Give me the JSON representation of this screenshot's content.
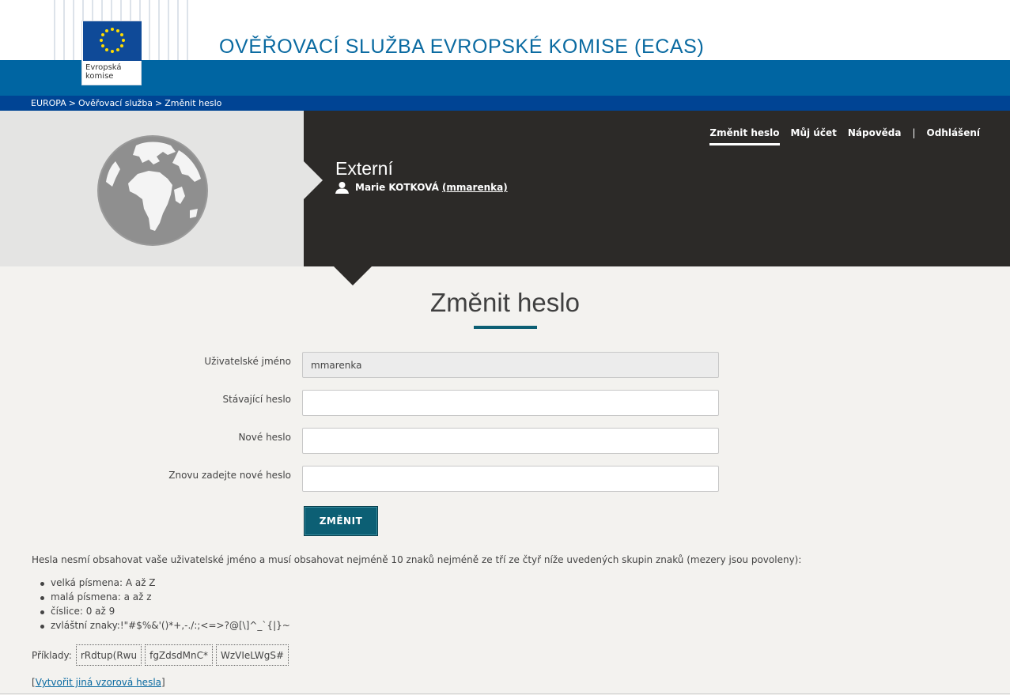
{
  "header": {
    "logo_text_line1": "Evropská",
    "logo_text_line2": "komise",
    "site_title": "OVĚŘOVACÍ SLUŽBA EVROPSKÉ KOMISE (ECAS)"
  },
  "breadcrumb": [
    "EUROPA",
    "Ověřovací služba",
    "Změnit heslo"
  ],
  "nav": {
    "change_password": "Změnit heslo",
    "my_account": "Můj účet",
    "help": "Nápověda",
    "separator": "|",
    "logout": "Odhlášení"
  },
  "hero": {
    "title": "Externí",
    "user_name": "Marie KOTKOVÁ",
    "user_login": "(mmarenka)"
  },
  "form": {
    "title": "Změnit heslo",
    "username_label": "Uživatelské jméno",
    "username_value": "mmarenka",
    "current_password_label": "Stávající heslo",
    "new_password_label": "Nové heslo",
    "confirm_password_label": "Znovu zadejte nové heslo",
    "submit_label": "ZMĚNIT"
  },
  "rules": {
    "intro": "Hesla nesmí obsahovat vaše uživatelské jméno a musí obsahovat nejméně 10 znaků nejméně ze tří ze čtyř níže uvedených skupin znaků (mezery jsou povoleny):",
    "items": [
      "velká písmena: A až Z",
      "malá písmena: a až z",
      "číslice: 0 až 9",
      "zvláštní znaky:!\"#$%&'()*+,-./:;<=>?@[\\]^_`{|}~"
    ],
    "examples_label": "Příklady:",
    "examples": [
      "rRdtup(Rwu",
      "fgZdsdMnC*",
      "WzVIeLWgS#"
    ],
    "generate_open": "[",
    "generate_link": "Vytvořit jiná vzorová hesla",
    "generate_close": "]"
  },
  "colors": {
    "brand_blue": "#0065a2",
    "breadcrumb_blue": "#004494",
    "hero_dark": "#2c2a28",
    "accent_teal": "#0c5f74",
    "title_blue": "#0a6aa1"
  }
}
